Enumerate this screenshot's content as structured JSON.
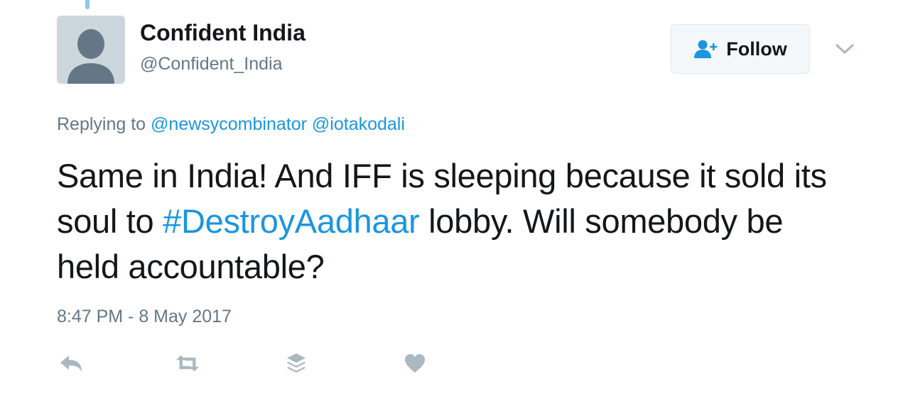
{
  "colors": {
    "link": "#1b95e0",
    "secondary_text": "#657786",
    "primary_text": "#14171a",
    "icon_gray": "#aab8c2",
    "thread_line": "#8fc7e8"
  },
  "author": {
    "display_name": "Confident India",
    "screen_name": "@Confident_India",
    "avatar_icon": "default-profile-silhouette-icon"
  },
  "follow_button": {
    "label": "Follow",
    "icon": "add-user-icon"
  },
  "menu": {
    "icon": "chevron-down-icon"
  },
  "reply_context": {
    "prefix": "Replying to",
    "mentions": [
      "@newsycombinator",
      "@iotakodali"
    ]
  },
  "tweet": {
    "text_before_hashtag": "Same in India! And IFF is sleeping because it sold its soul to ",
    "hashtag": "#DestroyAadhaar",
    "text_after_hashtag": " lobby. Will somebody be held accountable?",
    "timestamp": "8:47 PM - 8 May 2017"
  },
  "actions": [
    {
      "name": "reply",
      "icon": "reply-icon"
    },
    {
      "name": "retweet",
      "icon": "retweet-icon"
    },
    {
      "name": "buffer",
      "icon": "layers-icon"
    },
    {
      "name": "like",
      "icon": "heart-icon"
    }
  ]
}
